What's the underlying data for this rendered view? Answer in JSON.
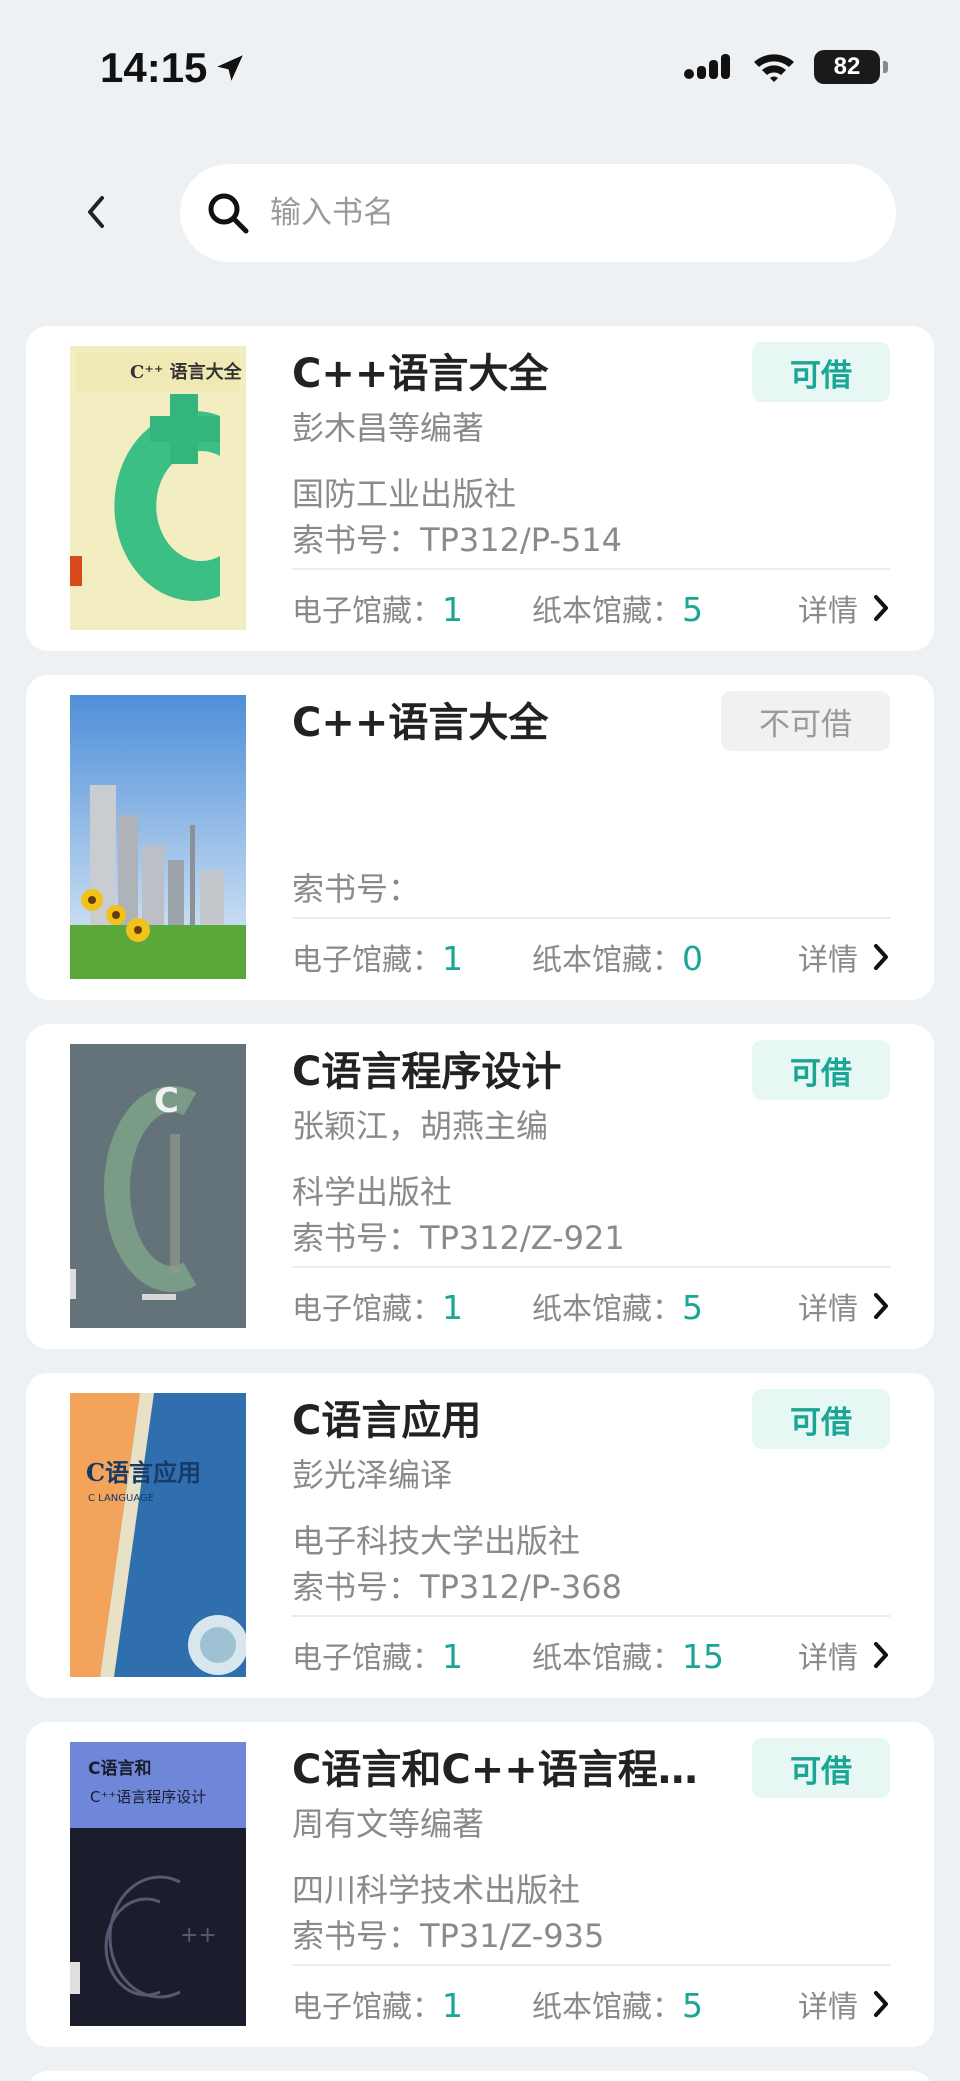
{
  "status": {
    "time": "14:15",
    "battery": "82"
  },
  "search": {
    "placeholder": "输入书名",
    "value": ""
  },
  "labels": {
    "call_prefix": "索书号：",
    "ebook_prefix": "电子馆藏：",
    "paper_prefix": "纸本馆藏：",
    "detail": "详情"
  },
  "books": [
    {
      "title": "C++语言大全",
      "status": "可借",
      "available": true,
      "author": "彭木昌等编著",
      "publisher": "国防工业出版社",
      "call_number": "TP312/P-514",
      "ebook": "1",
      "paper": "5",
      "cover": {
        "text": "C⁺⁺ 语言大全",
        "big": "C"
      }
    },
    {
      "title": "C++语言大全",
      "status": "不可借",
      "available": false,
      "author": "",
      "publisher": "",
      "call_number": "",
      "ebook": "1",
      "paper": "0"
    },
    {
      "title": "C语言程序设计",
      "status": "可借",
      "available": true,
      "author": "张颖江，胡燕主编",
      "publisher": "科学出版社",
      "call_number": "TP312/Z-921",
      "ebook": "1",
      "paper": "5",
      "cover": {
        "text": "C",
        "big": "C"
      }
    },
    {
      "title": "C语言应用",
      "status": "可借",
      "available": true,
      "author": "彭光泽编译",
      "publisher": "电子科技大学出版社",
      "call_number": "TP312/P-368",
      "ebook": "1",
      "paper": "15",
      "cover": {
        "text": "C语言应用",
        "sub": "C LANGUAGE"
      }
    },
    {
      "title": "C语言和C++语言程序设计",
      "status": "可借",
      "available": true,
      "author": "周有文等编著",
      "publisher": "四川科学技术出版社",
      "call_number": "TP31/Z-935",
      "ebook": "1",
      "paper": "5",
      "cover": {
        "text": "C语言和",
        "sub": "C⁺⁺语言程序设计",
        "big": "C"
      }
    }
  ]
}
